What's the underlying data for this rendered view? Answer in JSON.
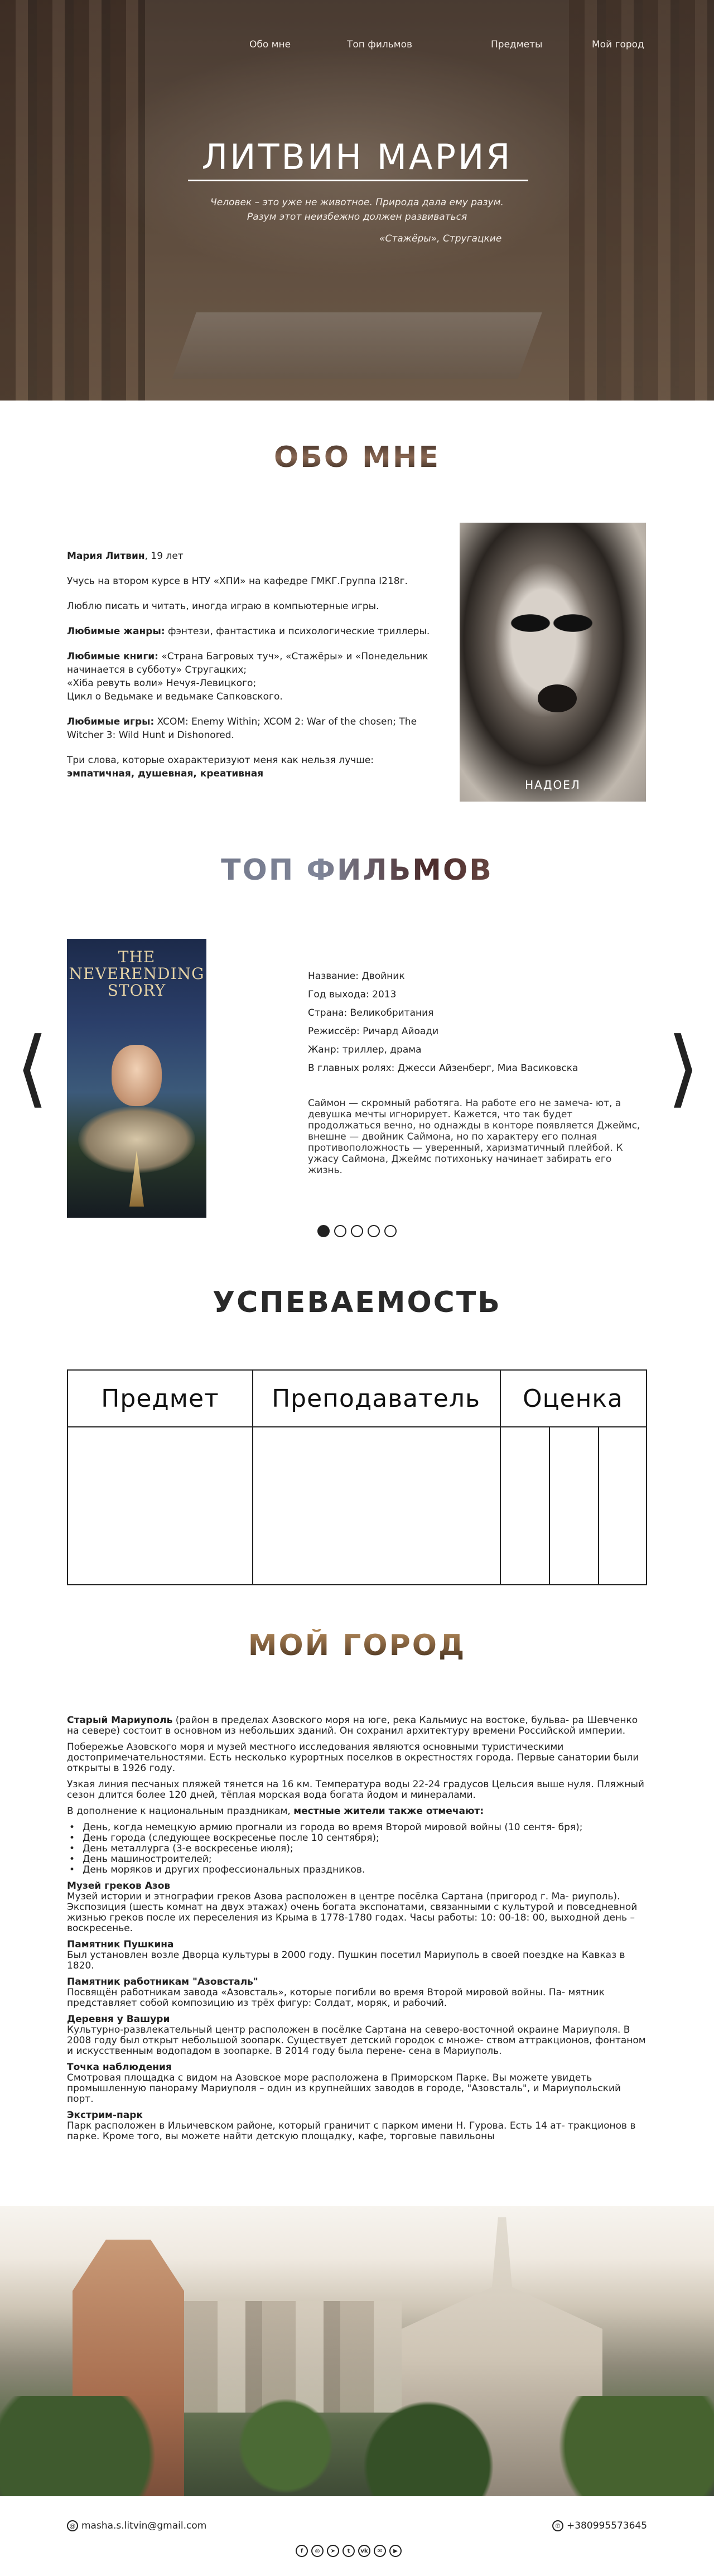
{
  "nav": {
    "items": [
      {
        "label": "Обо мне"
      },
      {
        "label": "Топ фильмов"
      },
      {
        "label": "Предметы"
      },
      {
        "label": "Мой город"
      }
    ]
  },
  "hero": {
    "title": "ЛИТВИН МАРИЯ",
    "quote_line1": "Человек – это уже не животное. Природа дала ему разум.",
    "quote_line2": "Разум этот неизбежно должен развиваться",
    "quote_author": "«Стажёры», Стругацкие"
  },
  "about": {
    "title": "ОБО МНЕ",
    "name": "Мария Литвин",
    "age": ", 19 лет",
    "study": "Учусь на втором курсе в НТУ «ХПИ» на кафедре ГМКГ.Группа I218г.",
    "hobby": "Люблю писать и читать, иногда играю в компьютерные игры.",
    "genres_label": "Любимые жанры:",
    "genres": " фэнтези, фантастика и психологические триллеры.",
    "books_label": "Любимые книги:",
    "books_line1": " «Страна Багровых туч», «Стажёры» и «Понедельник начинается в субботу» Стругацких;",
    "books_line2": "«Хіба ревуть воли» Нечуя-Левицкого;",
    "books_line3": "Цикл о Ведьмаке и ведьмаке Сапковского.",
    "games_label": "Любимые игры:",
    "games": " XCOM: Enemy Within; XCOM 2: War of the chosen; The Witcher 3: Wild Hunt и Dishonored.",
    "words_intro": "Три слова, которые охарактеризуют меня как нельзя лучше:",
    "words": "эмпатичная, душевная, креативная",
    "photo_caption": "НАДОЕЛ"
  },
  "films": {
    "title": "ТОП ФИЛЬМОВ",
    "poster_title": "THE NEVERENDING STORY",
    "name": "Название: Двойник",
    "year": "Год выхода: 2013",
    "country": "Страна: Великобритания",
    "director": "Режиссёр: Ричард Айоади",
    "genre": "Жанр: триллер, драма",
    "cast": "В главных ролях: Джесси Айзенберг, Миа Васиковска",
    "description": "Саймон — скромный работяга. На работе его не замеча- ют, а девушка мечты игнорирует. Кажется, что так будет продолжаться вечно, но однажды в конторе появляется Джеймс, внешне — двойник Саймона, но по характеру его полная противоположность — уверенный, харизматичный плейбой. К ужасу Саймона, Джеймс потихоньку начинает забирать его жизнь.",
    "prev_arrow": "⟨",
    "next_arrow": "⟩",
    "slides_total": 5,
    "slides_active": 1
  },
  "grades": {
    "title": "УСПЕВАЕМОСТЬ",
    "headers": [
      "Предмет",
      "Преподаватель",
      "Оценка"
    ]
  },
  "city": {
    "title": "МОЙ ГОРОД",
    "p1_bold": "Старый Мариуполь",
    "p1": " (район в пределах Азовского моря на юге, река Кальмиус на востоке, бульва- ра Шевченко на севере) состоит в основном из небольших зданий. Он сохранил архитектуру времени Российской империи.",
    "p2": "Побережье Азовского моря и музей местного исследования являются основными туристическими достопримечательностями. Есть несколько курортных поселков в окрестностях города. Первые санатории были открыты в 1926 году.",
    "p3": "Узкая линия песчаных пляжей тянется на 16 км. Температура воды 22-24 градусов Цельсия выше нуля. Пляжный сезон длится более 120 дней, тёплая морская вода богата йодом и минералами.",
    "p4_intro": "В дополнение к национальным праздникам, ",
    "p4_bold": "местные жители также отмечают:",
    "holidays": [
      "День, когда немецкую армию прогнали из города во время Второй мировой войны (10 сентя- бря);",
      "День города (следующее воскресенье после 10 сентября);",
      "День металлурга (3-е воскресенье июля);",
      "День машиностроителей;",
      "День моряков и других профессиональных праздников."
    ],
    "places": [
      {
        "name": "Музей греков Азов",
        "text": "Музей истории и этнографии греков Азова расположен в центре посёлка Сартана (пригород г. Ма- риуполь). Экспозиция (шесть комнат на двух этажах) очень богата экспонатами, связанными с культурой и повседневной жизнью греков после их переселения из Крыма в 1778-1780 годах. Часы работы: 10: 00-18: 00, выходной день – воскресенье."
      },
      {
        "name": "Памятник Пушкина",
        "text": "Был установлен возле Дворца культуры в 2000 году. Пушкин посетил Мариуполь в своей поездке на Кавказ в 1820."
      },
      {
        "name": "Памятник работникам \"Азовсталь\"",
        "text": "Посвящён работникам завода «Азовсталь», которые погибли во время Второй мировой войны. Па- мятник представляет собой композицию из трёх фигур: Солдат, моряк, и рабочий."
      },
      {
        "name": "Деревня у Вашури",
        "text": "Культурно-развлекательный центр расположен в посёлке Сартана на северо-восточной окраине Мариуполя. В 2008 году был открыт небольшой зоопарк. Существует детский городок с множе- ством аттракционов, фонтаном и искусственным водопадом в зоопарке. В 2014 году была перене- сена в Мариуполь."
      },
      {
        "name": "Точка наблюдения",
        "text": "Смотровая площадка с видом на Азовское море расположена в Приморском Парке. Вы можете увидеть промышленную панораму Мариуполя – один из крупнейших заводов в городе, \"Азовсталь\", и Мариупольский порт."
      },
      {
        "name": "Экстрим-парк",
        "text": "Парк расположен в Ильичевском районе, который граничит с парком имени Н. Гурова. Есть 14 ат- тракционов в парке. Кроме того, вы можете найти детскую площадку, кафе, торговые павильоны"
      }
    ]
  },
  "footer": {
    "email": "masha.s.litvin@gmail.com",
    "phone": "+380995573645",
    "socials": [
      "facebook-icon",
      "instagram-icon",
      "telegram-icon",
      "twitter-icon",
      "vk-icon",
      "mail-icon",
      "youtube-icon"
    ]
  }
}
